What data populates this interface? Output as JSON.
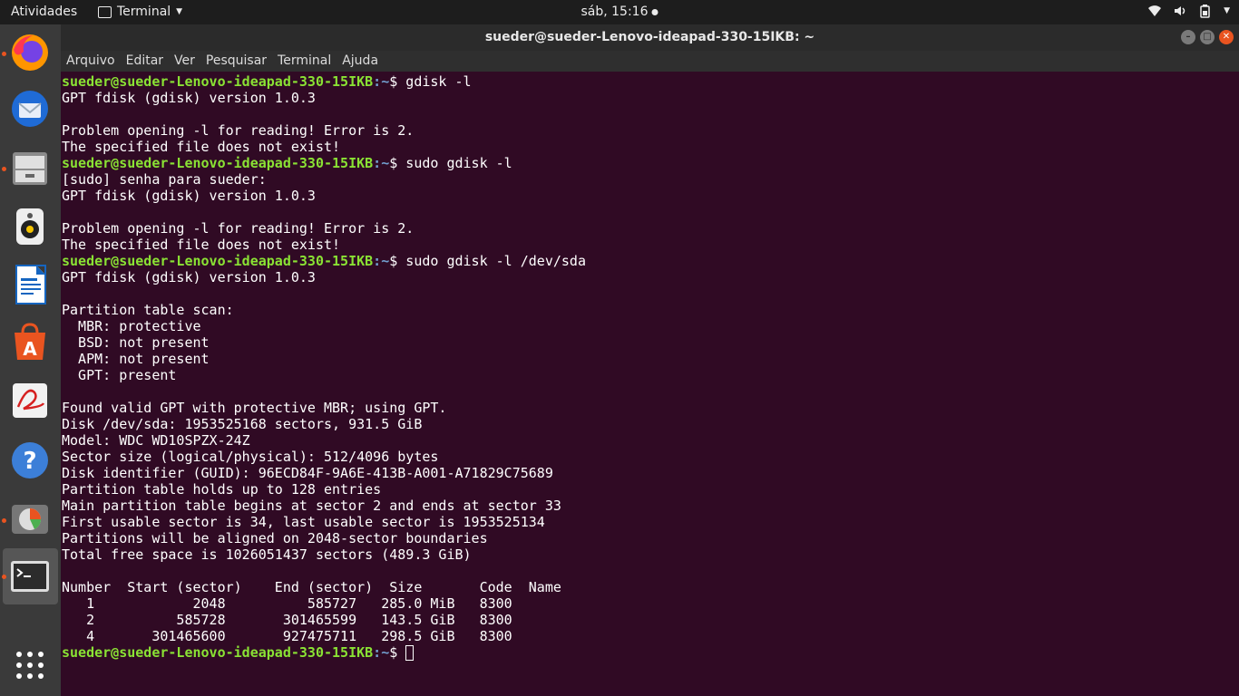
{
  "topbar": {
    "activities": "Atividades",
    "app_name": "Terminal",
    "clock": "sáb, 15:16"
  },
  "window": {
    "title": "sueder@sueder-Lenovo-ideapad-330-15IKB: ~",
    "menu": [
      "Arquivo",
      "Editar",
      "Ver",
      "Pesquisar",
      "Terminal",
      "Ajuda"
    ]
  },
  "dock": {
    "items": [
      "firefox-icon",
      "thunderbird-icon",
      "files-icon",
      "rhythmbox-icon",
      "writer-icon",
      "software-center-icon",
      "document-viewer-icon",
      "help-icon",
      "disk-usage-icon",
      "terminal-icon",
      "show-apps-icon"
    ]
  },
  "terminal": {
    "prompt_user": "sueder@sueder-Lenovo-ideapad-330-15IKB",
    "prompt_path": ":~",
    "lines": [
      {
        "type": "prompt",
        "cmd": "$ gdisk -l"
      },
      {
        "type": "out",
        "text": "GPT fdisk (gdisk) version 1.0.3"
      },
      {
        "type": "out",
        "text": ""
      },
      {
        "type": "out",
        "text": "Problem opening -l for reading! Error is 2."
      },
      {
        "type": "out",
        "text": "The specified file does not exist!"
      },
      {
        "type": "prompt",
        "cmd": "$ sudo gdisk -l"
      },
      {
        "type": "out",
        "text": "[sudo] senha para sueder:"
      },
      {
        "type": "out",
        "text": "GPT fdisk (gdisk) version 1.0.3"
      },
      {
        "type": "out",
        "text": ""
      },
      {
        "type": "out",
        "text": "Problem opening -l for reading! Error is 2."
      },
      {
        "type": "out",
        "text": "The specified file does not exist!"
      },
      {
        "type": "prompt",
        "cmd": "$ sudo gdisk -l /dev/sda"
      },
      {
        "type": "out",
        "text": "GPT fdisk (gdisk) version 1.0.3"
      },
      {
        "type": "out",
        "text": ""
      },
      {
        "type": "out",
        "text": "Partition table scan:"
      },
      {
        "type": "out",
        "text": "  MBR: protective"
      },
      {
        "type": "out",
        "text": "  BSD: not present"
      },
      {
        "type": "out",
        "text": "  APM: not present"
      },
      {
        "type": "out",
        "text": "  GPT: present"
      },
      {
        "type": "out",
        "text": ""
      },
      {
        "type": "out",
        "text": "Found valid GPT with protective MBR; using GPT."
      },
      {
        "type": "out",
        "text": "Disk /dev/sda: 1953525168 sectors, 931.5 GiB"
      },
      {
        "type": "out",
        "text": "Model: WDC WD10SPZX-24Z"
      },
      {
        "type": "out",
        "text": "Sector size (logical/physical): 512/4096 bytes"
      },
      {
        "type": "out",
        "text": "Disk identifier (GUID): 96ECD84F-9A6E-413B-A001-A71829C75689"
      },
      {
        "type": "out",
        "text": "Partition table holds up to 128 entries"
      },
      {
        "type": "out",
        "text": "Main partition table begins at sector 2 and ends at sector 33"
      },
      {
        "type": "out",
        "text": "First usable sector is 34, last usable sector is 1953525134"
      },
      {
        "type": "out",
        "text": "Partitions will be aligned on 2048-sector boundaries"
      },
      {
        "type": "out",
        "text": "Total free space is 1026051437 sectors (489.3 GiB)"
      },
      {
        "type": "out",
        "text": ""
      },
      {
        "type": "out",
        "text": "Number  Start (sector)    End (sector)  Size       Code  Name"
      },
      {
        "type": "out",
        "text": "   1            2048          585727   285.0 MiB   8300"
      },
      {
        "type": "out",
        "text": "   2          585728       301465599   143.5 GiB   8300"
      },
      {
        "type": "out",
        "text": "   4       301465600       927475711   298.5 GiB   8300"
      },
      {
        "type": "cursor",
        "cmd": "$ "
      }
    ]
  }
}
